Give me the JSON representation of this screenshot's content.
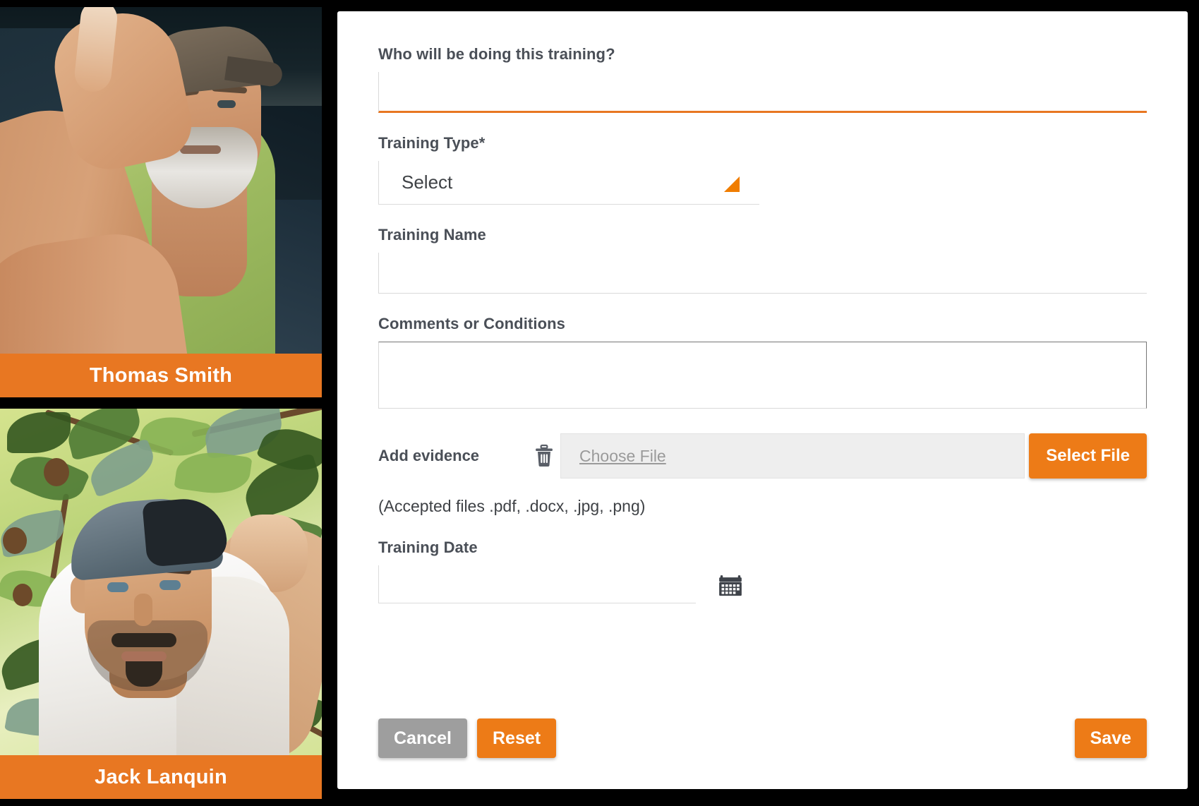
{
  "people": [
    {
      "name": "Thomas Smith",
      "photo_alt": "older man with gray beard and cap in vehicle cab wearing green t-shirt"
    },
    {
      "name": "Jack Lanquin",
      "photo_alt": "man in gray cap and white t-shirt picking fruit from a tree"
    }
  ],
  "form": {
    "who_label": "Who will be doing this training?",
    "who_value": "",
    "who_placeholder": "",
    "training_type_label": "Training Type*",
    "training_type_value": "Select",
    "training_name_label": "Training Name",
    "training_name_value": "",
    "comments_label": "Comments or Conditions",
    "comments_value": "",
    "evidence_label": "Add evidence",
    "delete_icon": "trash-icon",
    "choose_file_text": "Choose File",
    "select_file_label": "Select File",
    "accepted_note": "(Accepted files .pdf, .docx, .jpg, .png)",
    "training_date_label": "Training Date",
    "training_date_value": "",
    "calendar_icon": "calendar-icon",
    "dropdown_icon": "dropdown-arrow-icon"
  },
  "actions": {
    "cancel_label": "Cancel",
    "reset_label": "Reset",
    "save_label": "Save"
  },
  "colors": {
    "accent_orange": "#E87722",
    "button_orange": "#ED7B17",
    "cancel_gray": "#9E9E9E",
    "label_gray": "#4a4f57",
    "page_background": "#000000",
    "panel_white": "#FFFFFF"
  }
}
